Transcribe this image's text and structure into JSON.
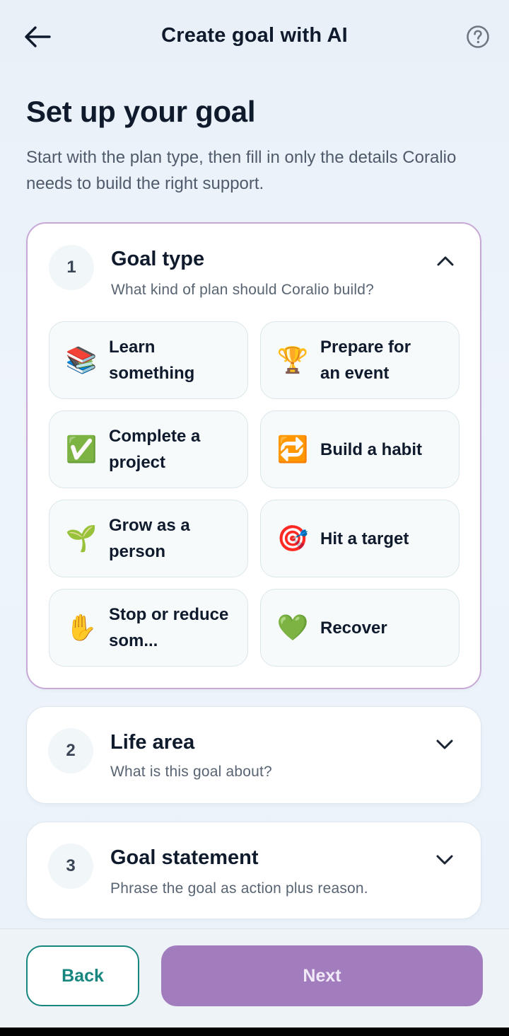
{
  "header": {
    "title": "Create goal with AI",
    "back_icon": "arrow-left-icon",
    "help_icon": "question-circle-icon"
  },
  "intro": {
    "title": "Set up your goal",
    "subtitle": "Start with the plan type, then fill in only the details Coralio needs to build the right support."
  },
  "steps": [
    {
      "number": "1",
      "title": "Goal type",
      "description": "What kind of plan should Coralio build?",
      "expanded": true,
      "options": [
        {
          "emoji": "📚",
          "icon": "books-icon",
          "label": "Learn something"
        },
        {
          "emoji": "🏆",
          "icon": "trophy-icon",
          "label": "Prepare for an event"
        },
        {
          "emoji": "✅",
          "icon": "check-mark-icon",
          "label": "Complete a project"
        },
        {
          "emoji": "🔁",
          "icon": "repeat-icon",
          "label": "Build a habit"
        },
        {
          "emoji": "🌱",
          "icon": "seedling-icon",
          "label": "Grow as a person"
        },
        {
          "emoji": "🎯",
          "icon": "target-icon",
          "label": "Hit a target"
        },
        {
          "emoji": "✋",
          "icon": "raised-hand-icon",
          "label": "Stop or reduce som..."
        },
        {
          "emoji": "💚",
          "icon": "green-heart-icon",
          "label": "Recover"
        }
      ]
    },
    {
      "number": "2",
      "title": "Life area",
      "description": "What is this goal about?",
      "expanded": false
    },
    {
      "number": "3",
      "title": "Goal statement",
      "description": "Phrase the goal as action plus reason.",
      "expanded": false
    }
  ],
  "footer": {
    "back_label": "Back",
    "next_label": "Next"
  },
  "colors": {
    "accent_purple": "#a27dbd",
    "accent_teal": "#17867f",
    "active_border": "#c8a9d6"
  }
}
